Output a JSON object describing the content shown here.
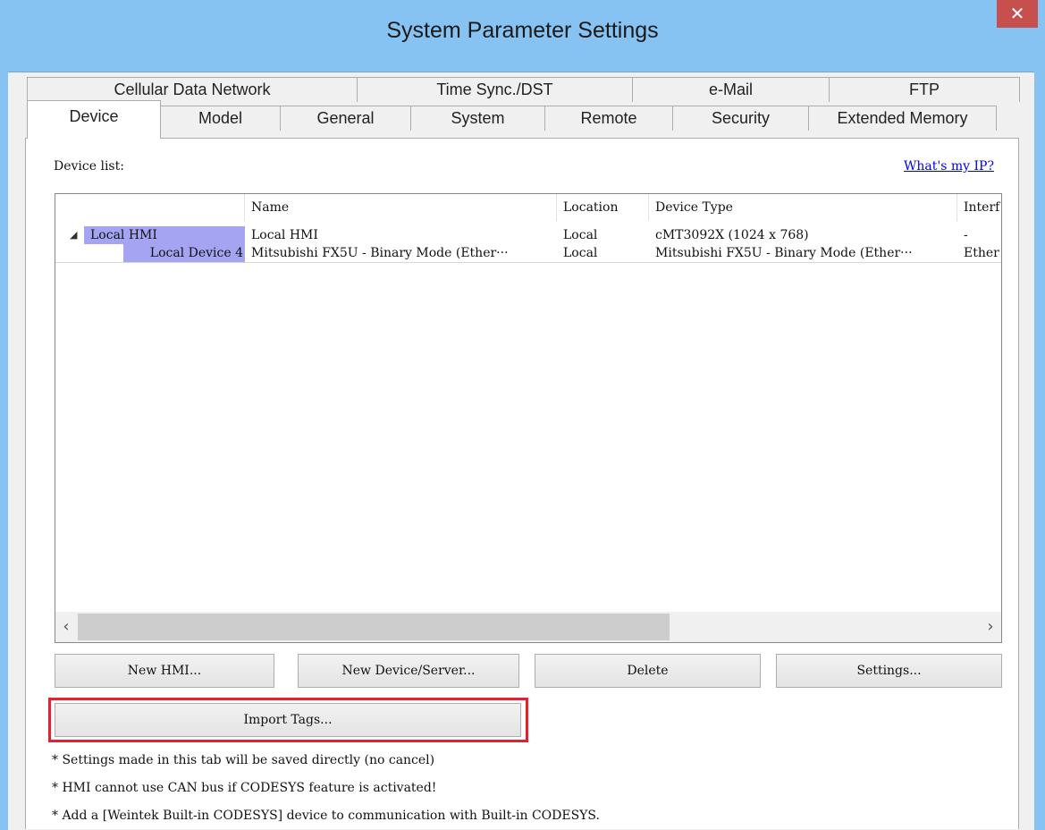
{
  "window": {
    "title": "System Parameter Settings",
    "close_glyph": "✕"
  },
  "tabs_back": [
    "Cellular Data Network",
    "Time Sync./DST",
    "e-Mail",
    "FTP"
  ],
  "tabs_front": [
    "Device",
    "Model",
    "General",
    "System",
    "Remote",
    "Security",
    "Extended Memory"
  ],
  "active_tab": "Device",
  "device_list": {
    "label": "Device list:",
    "whats_my_ip": "What's my IP?",
    "columns": [
      "",
      "Name",
      "Location",
      "Device Type",
      "Interf"
    ],
    "rows": [
      {
        "node": "Local HMI",
        "name": "Local HMI",
        "location": "Local",
        "device_type": "cMT3092X (1024 x 768)",
        "interface": "-",
        "expanded_glyph": "◢"
      },
      {
        "node": "Local Device 4",
        "name": "Mitsubishi FX5U - Binary Mode (Ether···",
        "location": "Local",
        "device_type": "Mitsubishi FX5U - Binary Mode (Ether···",
        "interface": "Ether"
      }
    ],
    "scroll_left": "‹",
    "scroll_right": "›"
  },
  "buttons": {
    "new_hmi": "New HMI...",
    "new_device": "New Device/Server...",
    "delete": "Delete",
    "settings": "Settings...",
    "import_tags": "Import Tags..."
  },
  "notes": [
    "* Settings made in this tab will be saved directly (no cancel)",
    "* HMI cannot use CAN bus if CODESYS feature is activated!",
    "* Add a [Weintek Built-in CODESYS] device to communication with Built-in CODESYS."
  ],
  "colors": {
    "titlebar": "#86c3f3",
    "close": "#c7504f",
    "node_highlight": "#a4a4f2",
    "import_highlight": "#e0232e",
    "link": "#0000ee"
  }
}
